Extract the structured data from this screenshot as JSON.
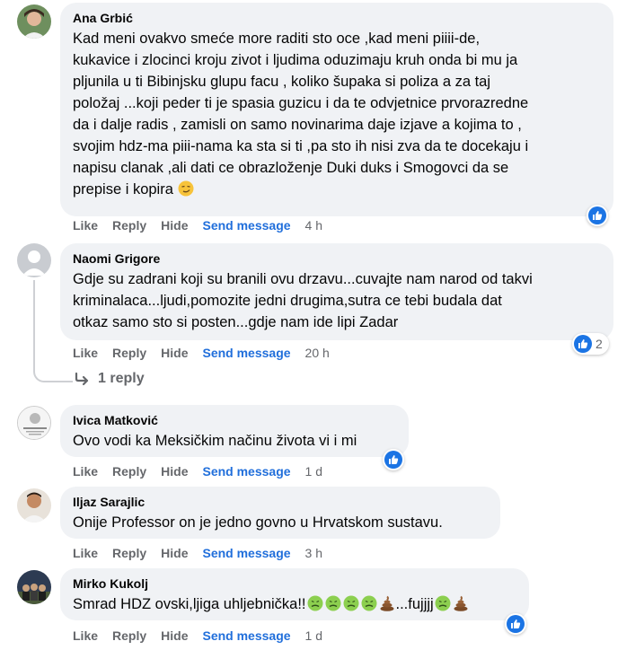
{
  "comments": [
    {
      "author": "Ana Grbić",
      "text": "Kad meni ovakvo smeće more raditi sto oce ,kad meni piiii-de,\nkukavice i zlocinci kroju zivot i ljudima oduzimaju kruh onda bi mu ja\npljunila u ti Bibinjsku glupu facu , koliko šupaka si poliza a za taj\npoložaj ...koji peder ti je spasia guzicu i da te odvjetnice prvorazredne\nda i dalje radis , zamisli on samo novinarima daje izjave a kojima to ,\nsvojim hdz-ma piii-nama ka sta si ti ,pa sto ih nisi zva da te docekaju i\nnapisu clanak ,ali dati ce obrazloženje Duki duks i Smogovci da se\nprepise i kopira",
      "emoji": "smirk",
      "actions": {
        "like": "Like",
        "reply": "Reply",
        "hide": "Hide",
        "send": "Send message"
      },
      "time": "4 h",
      "reaction_count": ""
    },
    {
      "author": "Naomi Grigore",
      "text": "Gdje su zadrani koji su branili ovu drzavu...cuvajte nam narod od takvi\nkriminalaca...ljudi,pomozite jedni drugima,sutra ce tebi budala dat\notkaz samo sto si posten...gdje nam ide lipi Zadar",
      "actions": {
        "like": "Like",
        "reply": "Reply",
        "hide": "Hide",
        "send": "Send message"
      },
      "time": "20 h",
      "reaction_count": "2",
      "replies_label": "1 reply"
    },
    {
      "author": "Ivica Matković",
      "text": "Ovo vodi ka Meksičkim načinu života vi i mi",
      "actions": {
        "like": "Like",
        "reply": "Reply",
        "hide": "Hide",
        "send": "Send message"
      },
      "time": "1 d",
      "reaction_count": ""
    },
    {
      "author": "Iljaz Sarajlic",
      "text": "Onije Professor on je jedno govno u Hrvatskom sustavu.",
      "actions": {
        "like": "Like",
        "reply": "Reply",
        "hide": "Hide",
        "send": "Send message"
      },
      "time": "3 h"
    },
    {
      "author": "Mirko Kukolj",
      "text_start": "Smrad HDZ ovski,ljiga uhljebnička!!",
      "text_mid": "...fujjjj",
      "actions": {
        "like": "Like",
        "reply": "Reply",
        "hide": "Hide",
        "send": "Send message"
      },
      "time": "1 d",
      "reaction_count": ""
    }
  ],
  "colors": {
    "bubble": "#f0f2f5",
    "link": "#216fdb",
    "meta": "#65676b",
    "like": "#1b74e4"
  },
  "icons": [
    "thumbs-up-icon",
    "reply-arrow-icon",
    "nauseated-face-emoji",
    "poop-emoji",
    "smirk-emoji"
  ]
}
